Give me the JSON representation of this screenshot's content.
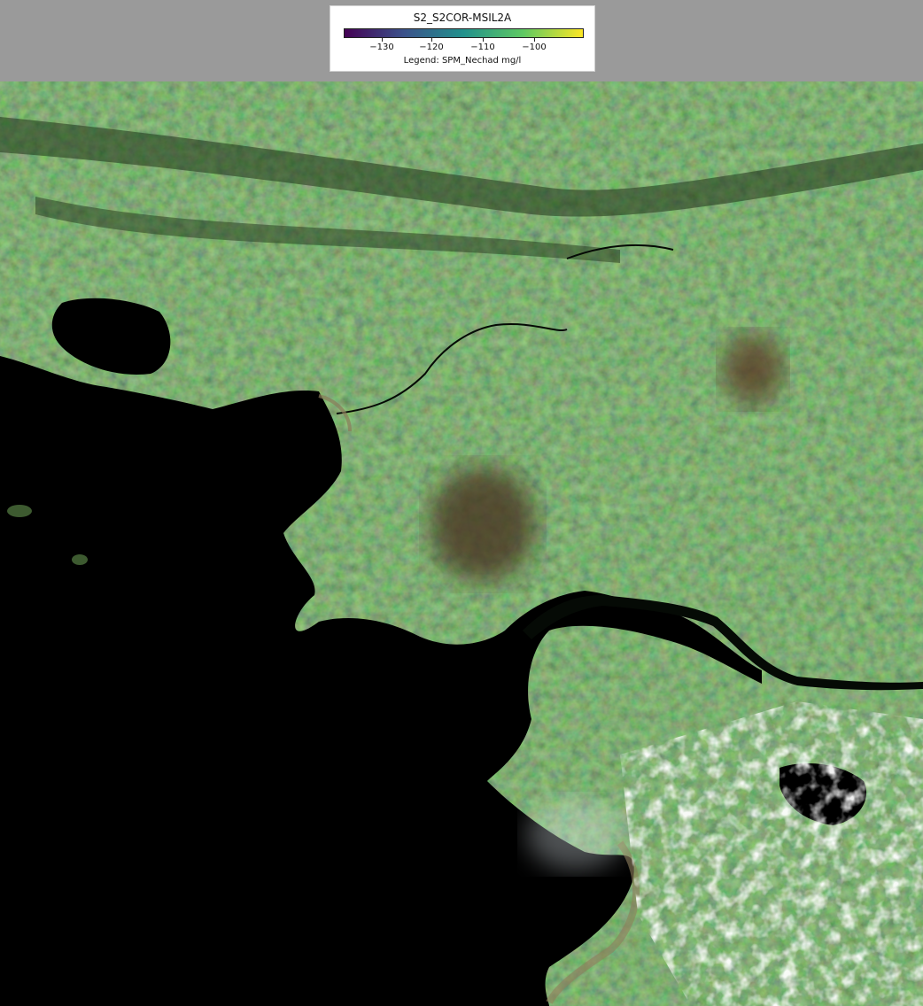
{
  "legend": {
    "title": "S2_S2COR-MSIL2A",
    "caption": "Legend: SPM_Nechad mg/l",
    "ticks": [
      "−130",
      "−120",
      "−110",
      "−100"
    ],
    "tick_values": [
      -130,
      -120,
      -110,
      -100
    ],
    "range": [
      -136,
      -92
    ],
    "colormap": "viridis",
    "colormap_stops": [
      "#440154",
      "#3b528b",
      "#21918c",
      "#5ec962",
      "#fde725"
    ]
  },
  "map": {
    "land_color": "#3a5a2c",
    "water_color": "#000000",
    "cloud_color": "#f4f6f8",
    "river_color": "#050a05"
  }
}
